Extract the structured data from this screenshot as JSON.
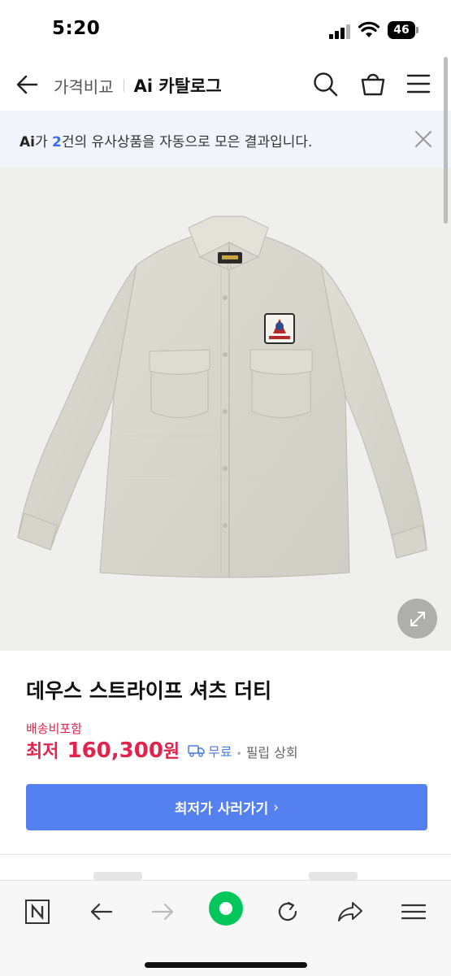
{
  "status_bar": {
    "time": "5:20",
    "battery": "46"
  },
  "header": {
    "compare_label": "가격비교",
    "catalog_ai": "Ai",
    "catalog_label": "카탈로그",
    "icons": [
      "back-arrow-icon",
      "search-icon",
      "shopping-bag-icon",
      "menu-icon"
    ]
  },
  "banner": {
    "ai": "Ai",
    "prefix": "가 ",
    "count": "2",
    "suffix": "건의 유사상품을 자동으로 모은 결과입니다."
  },
  "product": {
    "image_alt": "DEUS",
    "title": "데우스 스트라이프 셔츠 더티",
    "shipping_note": "배송비포함",
    "price_label": "최저",
    "price_value": "160,300",
    "price_unit": "원",
    "delivery": "무료",
    "seller": "필립 상회"
  },
  "buy_button": {
    "label": "최저가 사러가기",
    "chevron": "›"
  },
  "colors": {
    "accent_blue": "#5580f0",
    "price_red": "#e0244c",
    "banner_bg": "#f1f4fa",
    "naver_green": "#03c75a"
  },
  "toolbar": {
    "icons": [
      "naver-n-icon",
      "back-icon",
      "forward-icon",
      "green-dot-icon",
      "refresh-icon",
      "share-icon",
      "menu-icon"
    ]
  }
}
